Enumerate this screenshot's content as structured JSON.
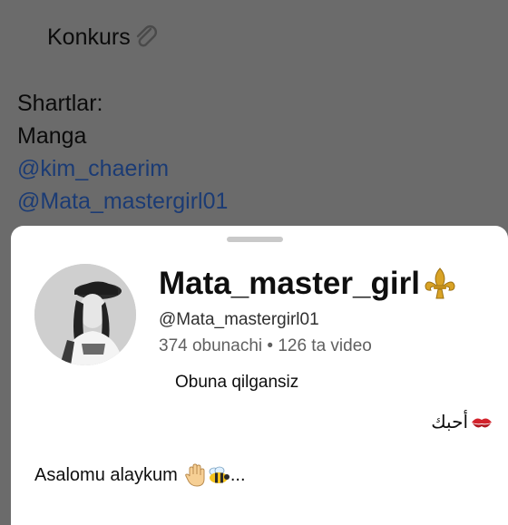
{
  "post": {
    "title": "Konkurs",
    "lines": [
      {
        "text": "Shartlar:",
        "mention": false
      },
      {
        "text": "Manga",
        "mention": false
      },
      {
        "text": "@kim_chaerim",
        "mention": true
      },
      {
        "text": "@Mata_mastergirl01",
        "mention": true
      }
    ]
  },
  "sheet": {
    "channel_name": "Mata_master_girl",
    "handle": "@Mata_mastergirl01",
    "subscribers": "374 obunachi",
    "separator": "•",
    "videos": "126 ta video",
    "subscribed_label": "Obuna qilgansiz",
    "arabic_text": "أحبك",
    "greeting": "Asalomu alaykum",
    "greeting_trail": "..."
  },
  "icons": {
    "title_icon": "paperclip-icon",
    "name_icon": "fleur-de-lis-icon",
    "kiss_icon": "kiss-mark-icon",
    "hand_icon": "raised-hand-icon",
    "bee_icon": "bee-icon"
  },
  "colors": {
    "overlay_bg": "#6b6b6b",
    "mention": "#1b3b74",
    "sheet_bg": "#ffffff",
    "secondary_text": "#606060"
  }
}
